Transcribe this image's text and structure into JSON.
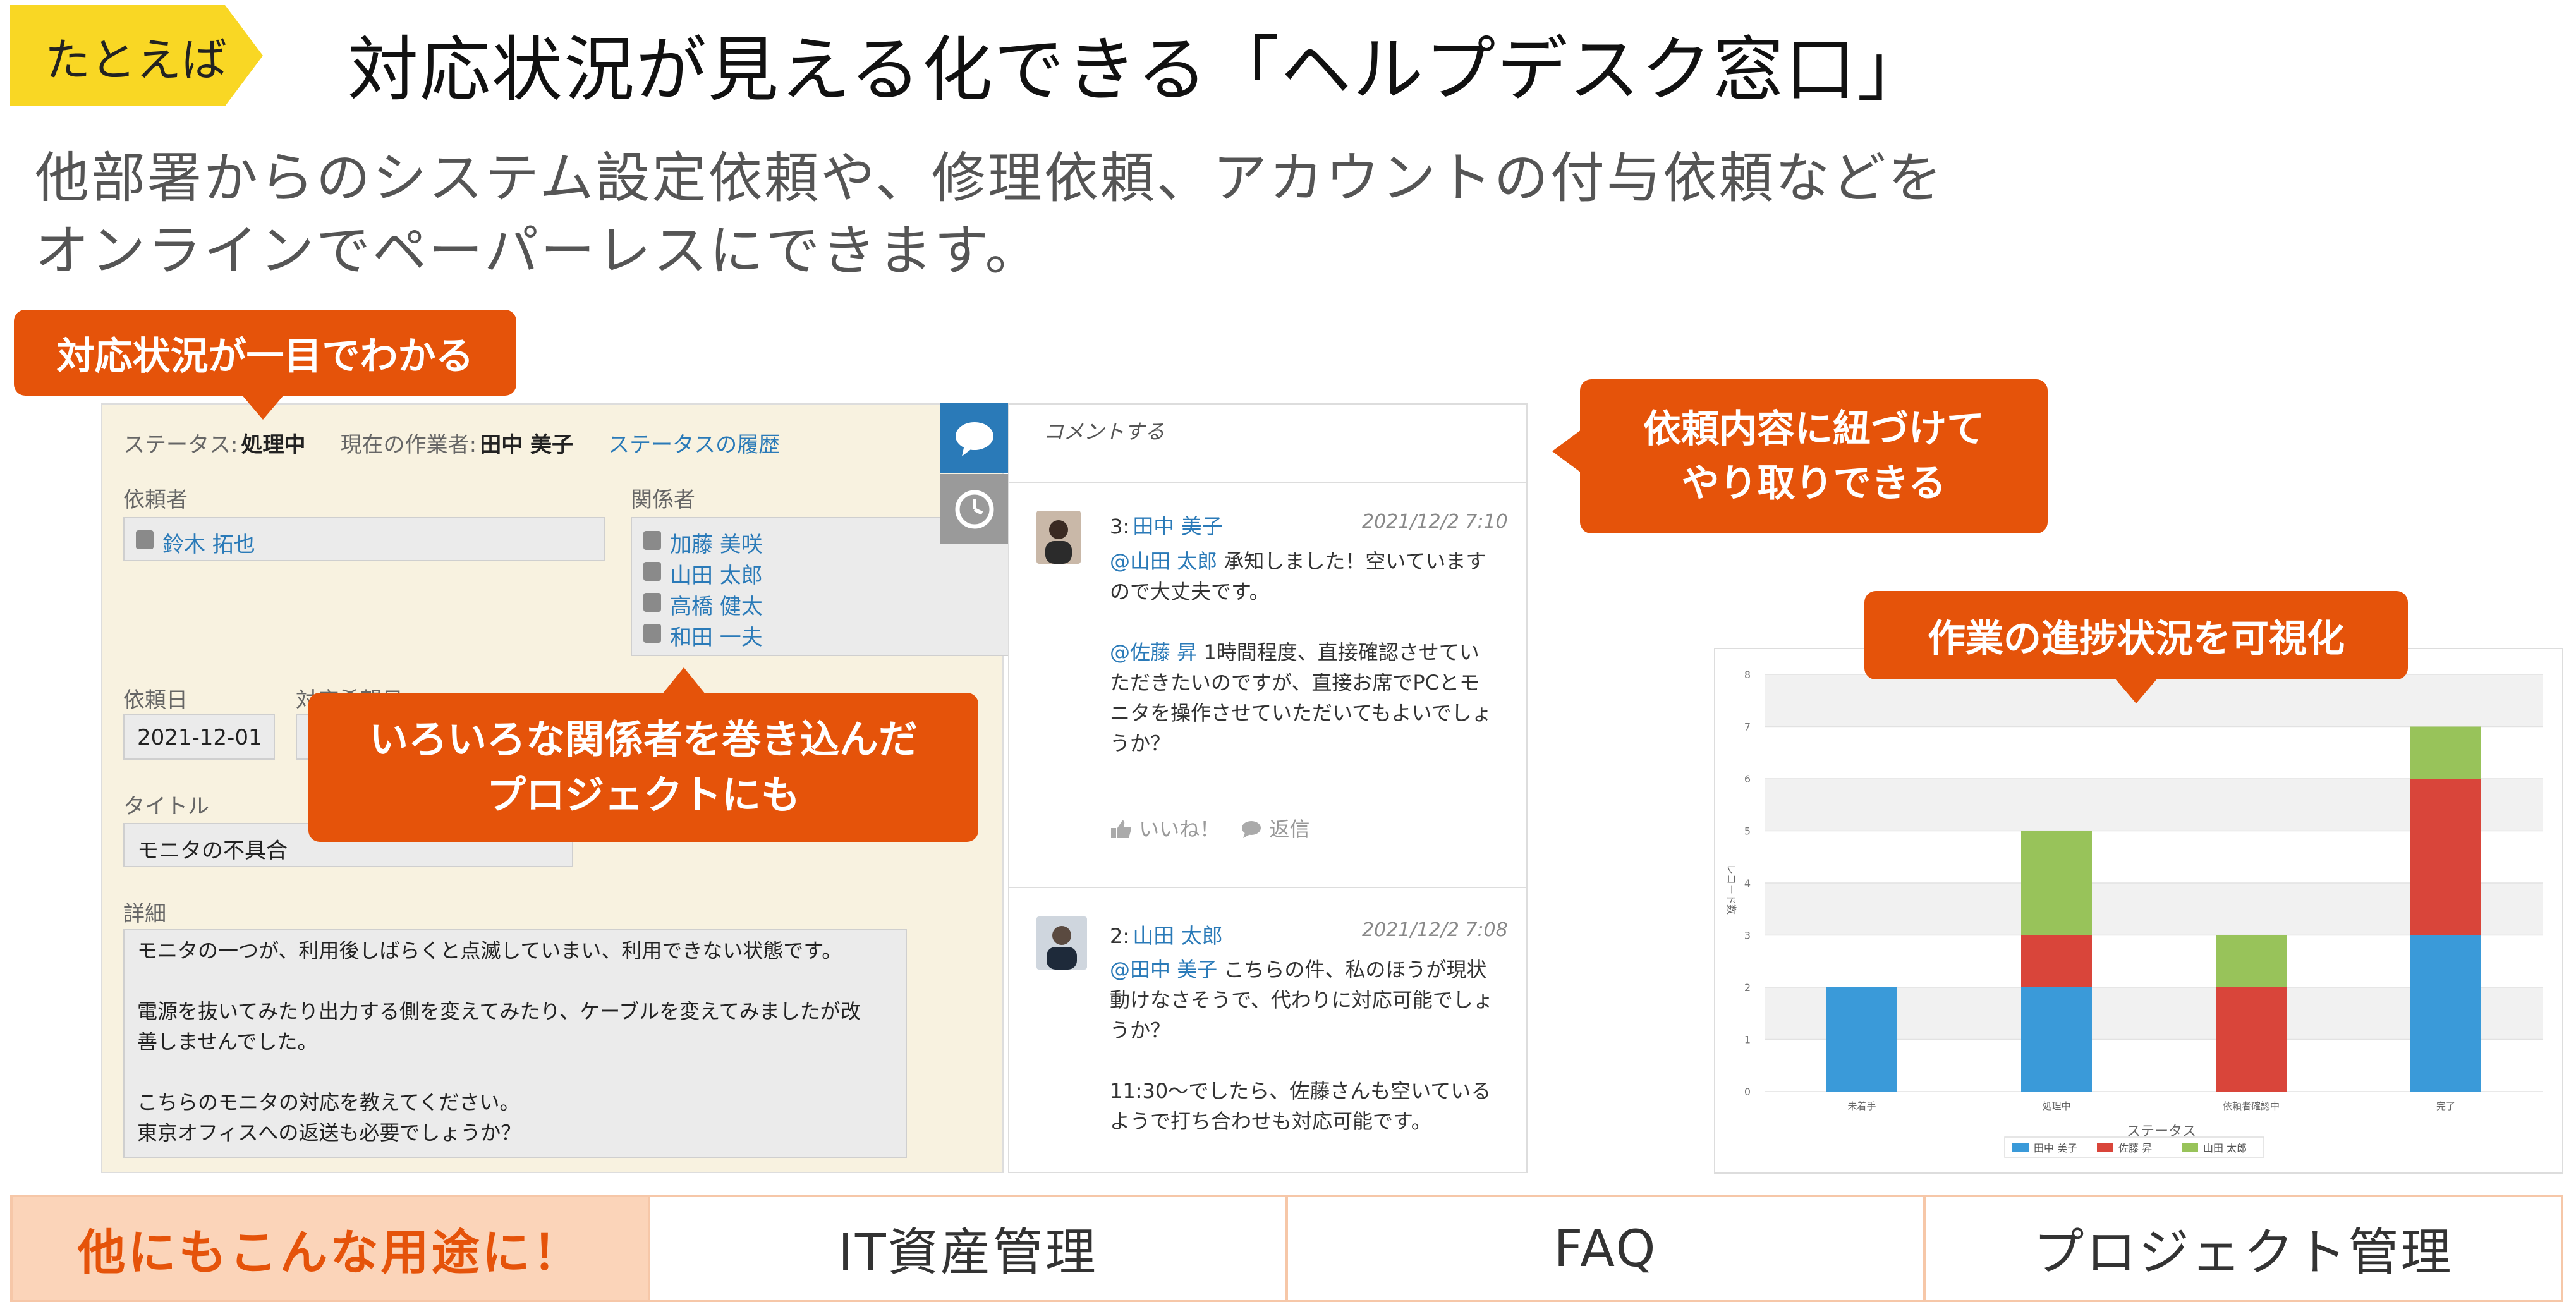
{
  "header": {
    "tag": "たとえば",
    "title": "対応状況が見える化できる「ヘルプデスク窓口」",
    "lead_line1": "他部署からのシステム設定依頼や、修理依頼、アカウントの付与依頼などを",
    "lead_line2": "オンラインでペーパーレスにできます。"
  },
  "callouts": {
    "status": "対応状況が一目でわかる",
    "stakeholders_line1": "いろいろな関係者を巻き込んだ",
    "stakeholders_line2": "プロジェクトにも",
    "comments_line1": "依頼内容に紐づけて",
    "comments_line2": "やり取りできる",
    "chart": "作業の進捗状況を可視化"
  },
  "form": {
    "status_label": "ステータス:",
    "status_value": "処理中",
    "worker_label": "現在の作業者:",
    "worker_value": "田中 美子",
    "history_link": "ステータスの履歴",
    "requester_label": "依頼者",
    "requester": "鈴木 拓也",
    "related_label": "関係者",
    "related": [
      "加藤 美咲",
      "山田 太郎",
      "高橋 健太",
      "和田 一夫"
    ],
    "date_label": "依頼日",
    "date_value": "2021-12-01",
    "desired_label": "対応希望日",
    "title_label": "タイトル",
    "title_value": "モニタの不具合",
    "detail_label": "詳細",
    "detail_lines": [
      "モニタの一つが、利用後しばらくと点滅していまい、利用できない状態です。",
      "",
      "電源を抜いてみたり出力する側を変えてみたり、ケーブルを変えてみましたが改",
      "善しませんでした。",
      "",
      "こちらのモニタの対応を教えてください。",
      "東京オフィスへの返送も必要でしょうか？"
    ]
  },
  "comments": {
    "header": "コメントする",
    "items": [
      {
        "num": "3:",
        "name": "田中 美子",
        "date": "2021/12/2 7:10",
        "lines": [
          {
            "mention": "@山田 太郎",
            "text": " 承知しました！空いています"
          },
          {
            "mention": "",
            "text": "ので大丈夫です。"
          },
          {
            "mention": "",
            "text": ""
          },
          {
            "mention": "@佐藤 昇",
            "text": " 1時間程度、直接確認させてい"
          },
          {
            "mention": "",
            "text": "ただきたいのですが、直接お席でPCとモ"
          },
          {
            "mention": "",
            "text": "ニタを操作させていただいてもよいでしょ"
          },
          {
            "mention": "",
            "text": "うか？"
          }
        ],
        "like": "いいね！",
        "reply": "返信"
      },
      {
        "num": "2:",
        "name": "山田 太郎",
        "date": "2021/12/2 7:08",
        "lines": [
          {
            "mention": "@田中 美子",
            "text": " こちらの件、私のほうが現状"
          },
          {
            "mention": "",
            "text": "動けなさそうで、代わりに対応可能でしょ"
          },
          {
            "mention": "",
            "text": "うか？"
          },
          {
            "mention": "",
            "text": ""
          },
          {
            "mention": "",
            "text": "11:30〜でしたら、佐藤さんも空いている"
          },
          {
            "mention": "",
            "text": "ようで打ち合わせも対応可能です。"
          }
        ]
      }
    ]
  },
  "chart_data": {
    "type": "bar",
    "stacked": true,
    "categories": [
      "未着手",
      "処理中",
      "依頼者確認中",
      "完了"
    ],
    "series": [
      {
        "name": "田中 美子",
        "color": "#3a9ad9",
        "values": [
          2,
          2,
          0,
          3
        ]
      },
      {
        "name": "佐藤 昇",
        "color": "#d9453a",
        "values": [
          0,
          1,
          2,
          3
        ]
      },
      {
        "name": "山田 太郎",
        "color": "#98c35a",
        "values": [
          0,
          2,
          1,
          1
        ]
      }
    ],
    "xlabel": "ステータス",
    "ylabel": "レコード数",
    "ylim": [
      0,
      8
    ],
    "yticks": [
      0,
      1,
      2,
      3,
      4,
      5,
      6,
      7,
      8
    ],
    "grid": true,
    "legend": "bottom"
  },
  "uses": {
    "label": "他にもこんな用途に！",
    "items": [
      "IT資産管理",
      "FAQ",
      "プロジェクト管理"
    ]
  }
}
